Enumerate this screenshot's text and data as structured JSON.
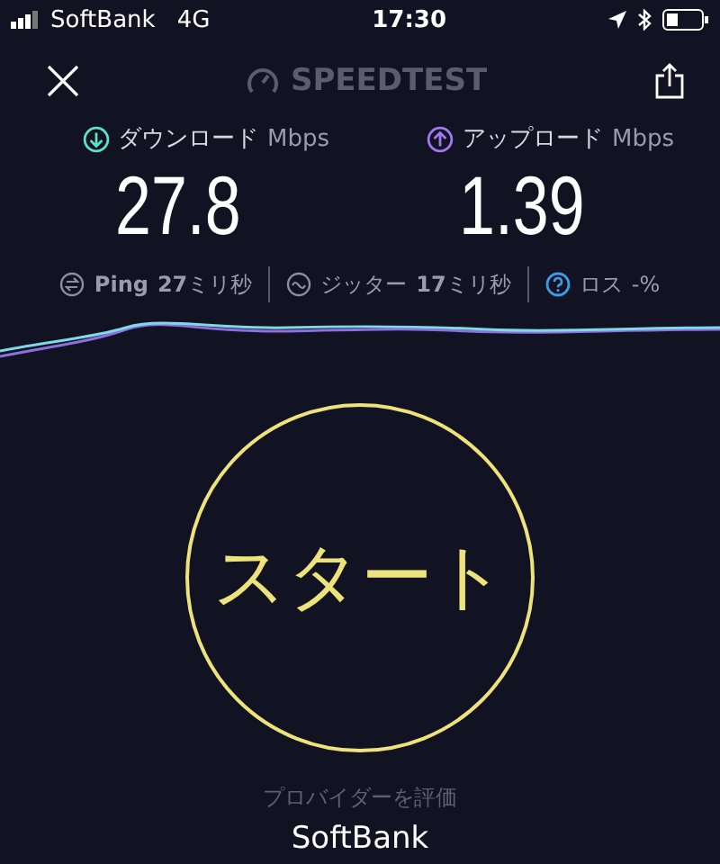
{
  "status_bar": {
    "carrier": "SoftBank",
    "network": "4G",
    "time": "17:30"
  },
  "header": {
    "title": "SPEEDTEST"
  },
  "results": [
    {
      "kind": "download",
      "label": "ダウンロード",
      "unit": "Mbps",
      "value": "27.8"
    },
    {
      "kind": "upload",
      "label": "アップロード",
      "unit": "Mbps",
      "value": "1.39"
    }
  ],
  "metrics": [
    {
      "kind": "ping",
      "label": "Ping",
      "value": "**27**ミリ秒"
    },
    {
      "kind": "jitter",
      "label": "ジッター",
      "value": "**17**ミリ秒"
    },
    {
      "kind": "loss",
      "label": "ロス",
      "value": "-%"
    }
  ],
  "start_button": {
    "label": "スタート"
  },
  "provider": {
    "label": "プロバイダーを評価",
    "name": "SoftBank"
  }
}
